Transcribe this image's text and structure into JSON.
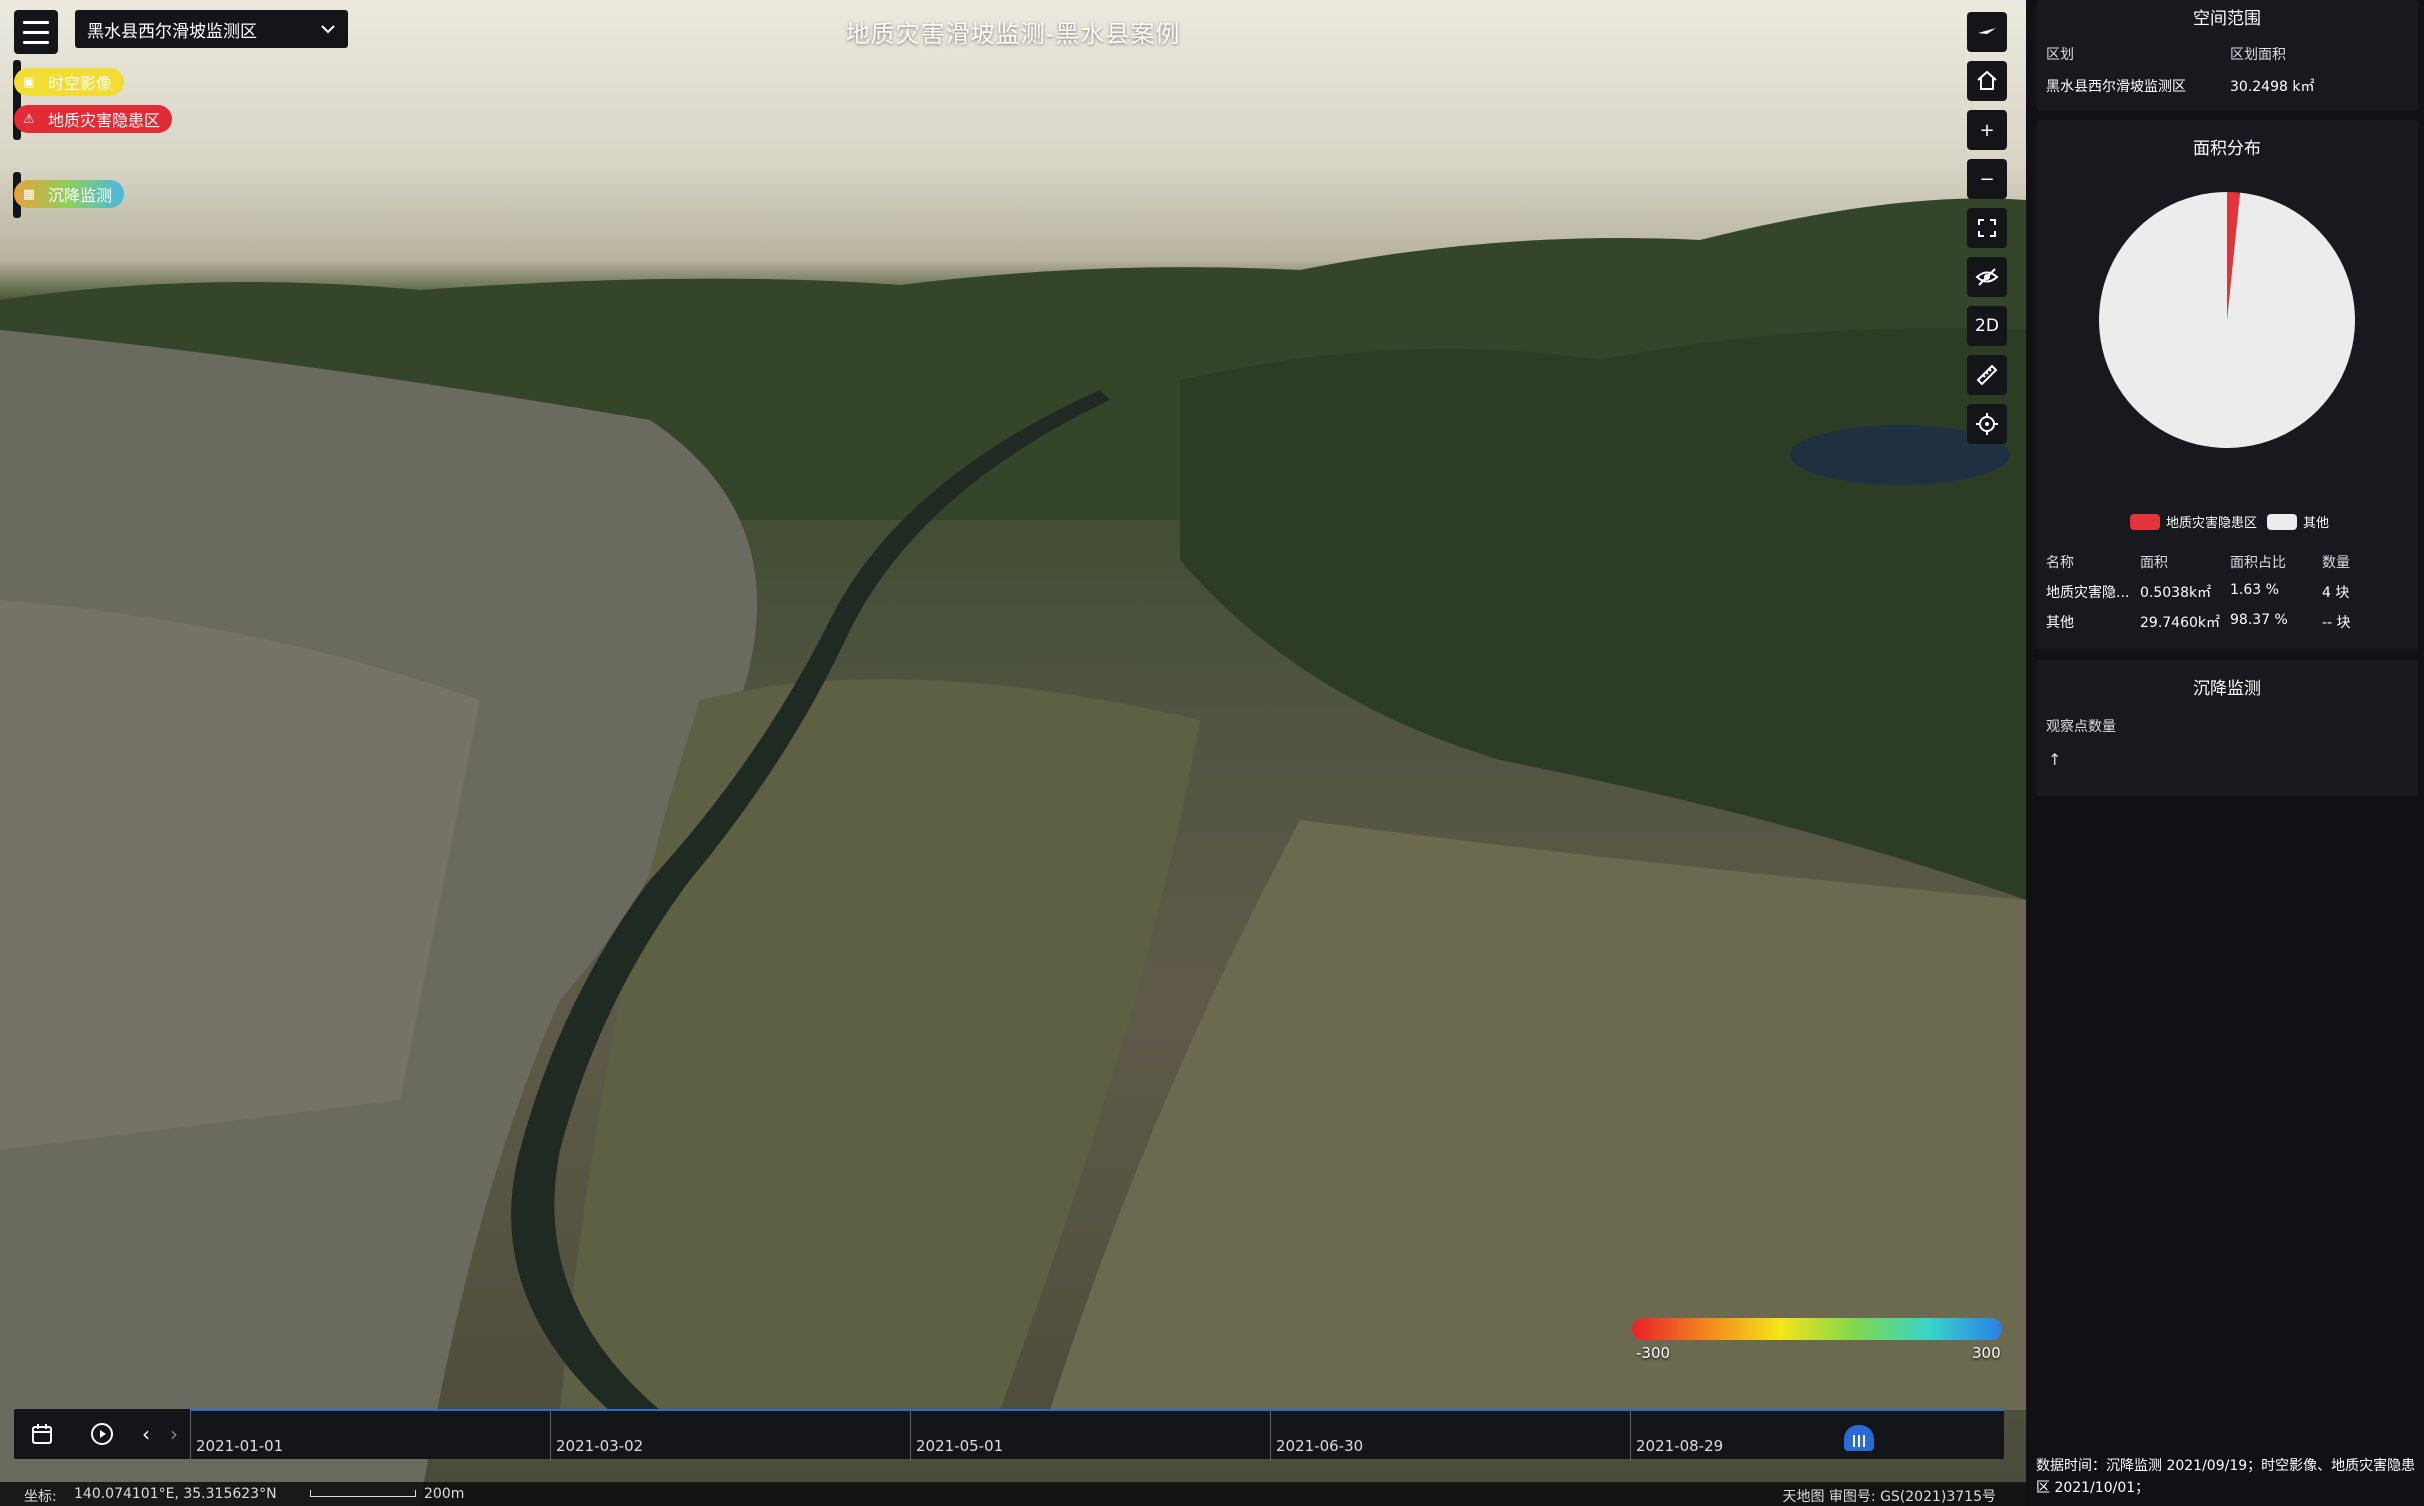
{
  "header": {
    "title": "地质灾害滑坡监测-黑水县案例",
    "region_select": "黑水县西尔滑坡监测区"
  },
  "layers": [
    {
      "label": "时空影像",
      "icon": "image-icon",
      "color": "#f3dc33"
    },
    {
      "label": "地质灾害隐患区",
      "icon": "warning-icon",
      "color": "#e22b35"
    },
    {
      "label": "沉降监测",
      "icon": "settlement-icon",
      "color": "#5bb8e8"
    }
  ],
  "toolbar": [
    {
      "name": "compass",
      "label": "",
      "icon": "compass-icon"
    },
    {
      "name": "home",
      "label": "",
      "icon": "home-icon"
    },
    {
      "name": "zoom-in",
      "label": "+",
      "icon": "zoom-in-icon"
    },
    {
      "name": "zoom-out",
      "label": "−",
      "icon": "zoom-out-icon"
    },
    {
      "name": "fullscreen",
      "label": "",
      "icon": "fullscreen-icon"
    },
    {
      "name": "hide",
      "label": "",
      "icon": "eye-off-icon"
    },
    {
      "name": "view-2d",
      "label": "2D",
      "icon": ""
    },
    {
      "name": "measure",
      "label": "",
      "icon": "ruler-icon"
    },
    {
      "name": "locate",
      "label": "",
      "icon": "locate-icon"
    }
  ],
  "color_legend": {
    "min": "-300",
    "max": "300"
  },
  "timeline": {
    "labels": [
      "2021-01-01",
      "2021-03-02",
      "2021-05-01",
      "2021-06-30",
      "2021-08-29"
    ],
    "current_fraction": 0.92
  },
  "status": {
    "coords_label": "坐标:",
    "coords_value": "140.074101°E, 35.315623°N",
    "scale": "200m",
    "attribution": "天地图 审图号: GS(2021)3715号"
  },
  "panel": {
    "spatial": {
      "title": "空间范围",
      "col1_header": "区划",
      "col2_header": "区划面积",
      "col1_value": "黑水县西尔滑坡监测区",
      "col2_value": "30.2498 k㎡"
    },
    "area": {
      "title": "面积分布",
      "legend": [
        {
          "label": "地质灾害隐患区",
          "color": "#e3343c"
        },
        {
          "label": "其他",
          "color": "#ececec"
        }
      ],
      "headers": [
        "名称",
        "面积",
        "面积占比",
        "数量"
      ],
      "rows": [
        [
          "地质灾害隐...",
          "0.5038k㎡",
          "1.63 %",
          "4 块"
        ],
        [
          "其他",
          "29.7460k㎡",
          "98.37 %",
          "-- 块"
        ]
      ]
    },
    "settlement": {
      "title": "沉降监测",
      "label": "观察点数量",
      "arrow": "↑"
    },
    "footer": "数据时间：沉降监测 2021/09/19；时空影像、地质灾害隐患区 2021/10/01；"
  },
  "chart_data": {
    "type": "pie",
    "title": "面积分布",
    "categories": [
      "地质灾害隐患区",
      "其他"
    ],
    "values": [
      1.63,
      98.37
    ],
    "colors": [
      "#e3343c",
      "#ececec"
    ]
  }
}
